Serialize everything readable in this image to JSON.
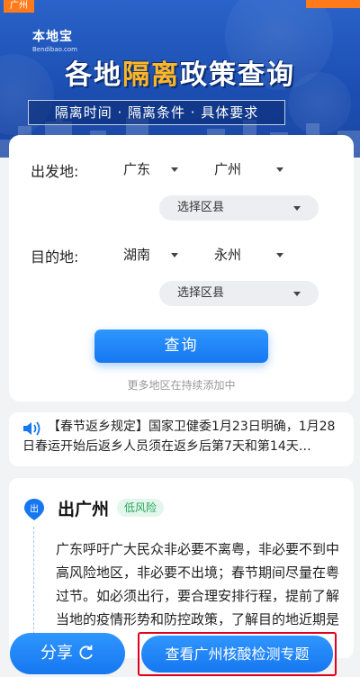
{
  "banner": {
    "city_tag": "广州",
    "logo_text": "本地宝",
    "logo_domain": "Bendibao.com",
    "title_prefix": "各地",
    "title_highlight": "隔离",
    "title_suffix": "政策查询",
    "subtitle": "隔离时间 · 隔离条件 · 具体要求"
  },
  "query": {
    "departure_label": "出发地:",
    "departure_province": "广东",
    "departure_city": "广州",
    "departure_district": "选择区县",
    "destination_label": "目的地:",
    "destination_province": "湖南",
    "destination_city": "永州",
    "destination_district": "选择区县",
    "submit_label": "查询",
    "more_note": "更多地区在持续添加中"
  },
  "notice": {
    "text": "【春节返乡规定】国家卫健委1月23日明确，1月28日春运开始后返乡人员须在返乡后第7天和第14天…"
  },
  "policy": {
    "title": "出广州",
    "pin_label": "出",
    "risk_badge": "低风险",
    "body": "广东呼吁广大民众非必要不离粤，非必要不到中高风险地区，非必要不出境；春节期间尽量在粤过节。如必须出行，要合理安排行程，提前了解当地的疫情形势和防控政策，了解目的地近期是"
  },
  "bottom": {
    "share_label": "分享",
    "topic_label": "查看广州核酸检测专题"
  },
  "colors": {
    "primary": "#1677f0",
    "banner_blue": "#1c4fb3",
    "highlight_orange": "#ffb726",
    "tag_orange": "#ff7a1a",
    "risk_green": "#27a55b",
    "annotation_red": "#e0001c"
  }
}
